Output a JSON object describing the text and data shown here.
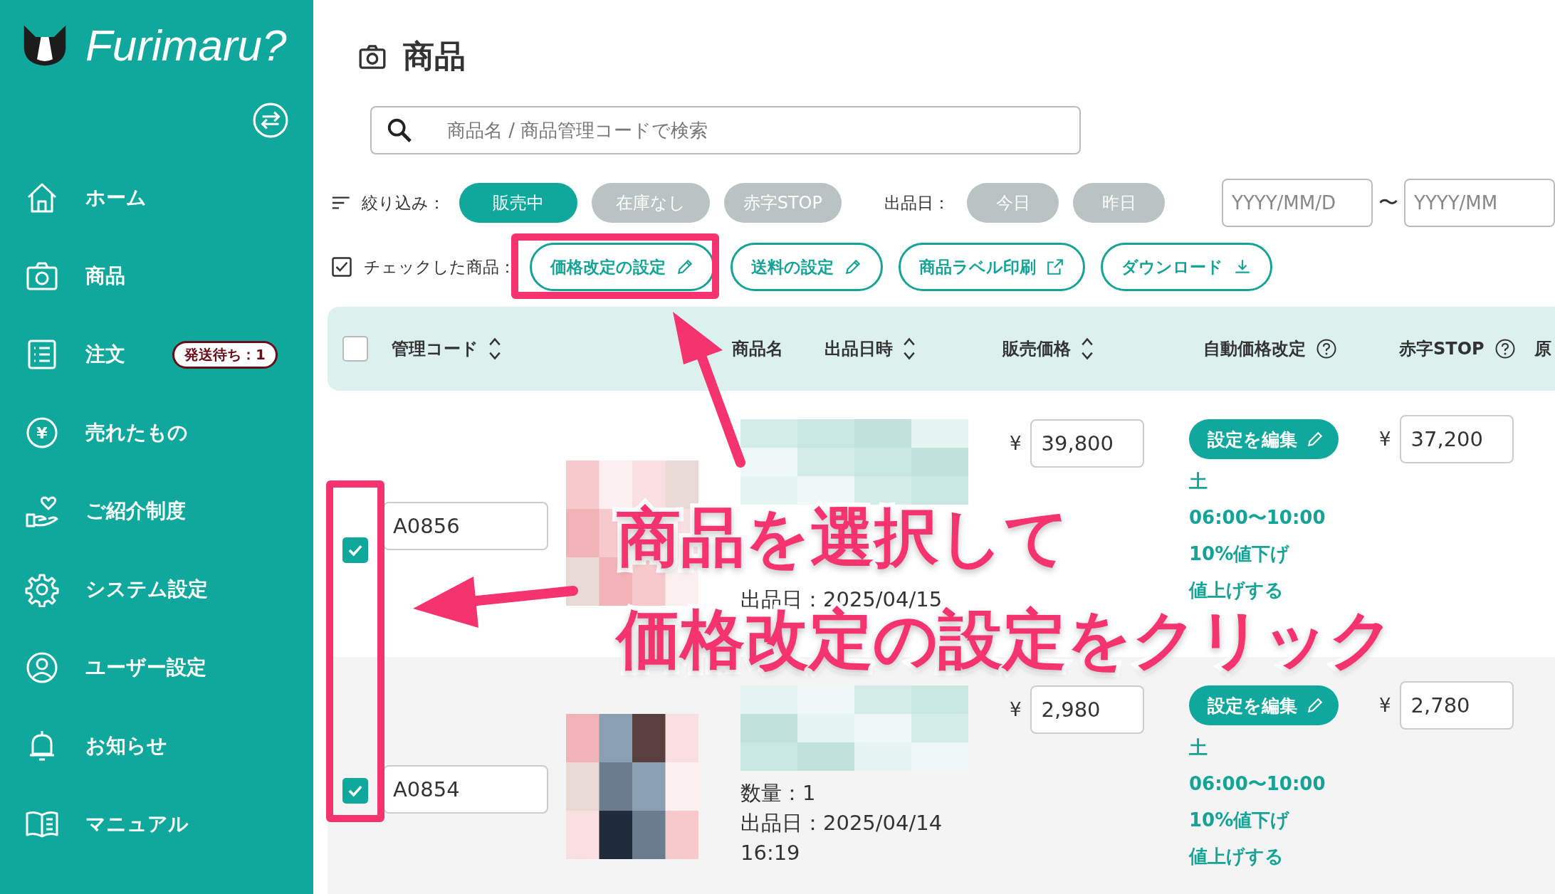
{
  "sidebar": {
    "logo": "Furimaru?",
    "items": [
      {
        "label": "ホーム"
      },
      {
        "label": "商品"
      },
      {
        "label": "注文",
        "badge": "発送待ち：1"
      },
      {
        "label": "売れたもの",
        "glyph": "¥"
      },
      {
        "label": "ご紹介制度"
      },
      {
        "label": "システム設定"
      },
      {
        "label": "ユーザー設定"
      },
      {
        "label": "お知らせ"
      },
      {
        "label": "マニュアル"
      }
    ]
  },
  "page_title": "商品",
  "search": {
    "placeholder": "商品名 / 商品管理コードで検索"
  },
  "filters": {
    "label": "絞り込み：",
    "status_chips": [
      {
        "label": "販売中",
        "selected": true
      },
      {
        "label": "在庫なし",
        "selected": false
      },
      {
        "label": "赤字STOP",
        "selected": false
      }
    ],
    "date_label": "出品日：",
    "date_chips": [
      {
        "label": "今日",
        "selected": false
      },
      {
        "label": "昨日",
        "selected": false
      }
    ],
    "date_from": {
      "placeholder": "YYYY/MM/D"
    },
    "separator": "〜",
    "date_to": {
      "placeholder": "YYYY/MM"
    }
  },
  "bulk": {
    "label": "チェックした商品：",
    "actions": [
      {
        "label": "価格改定の設定",
        "kind": "edit"
      },
      {
        "label": "送料の設定",
        "kind": "edit"
      },
      {
        "label": "商品ラベル印刷",
        "kind": "external"
      },
      {
        "label": "ダウンロード",
        "kind": "download"
      }
    ]
  },
  "table": {
    "select_all": {
      "checked": false
    },
    "columns": [
      {
        "label": "管理コード",
        "kind": "sort"
      },
      {
        "label": "商品名",
        "kind": "plain"
      },
      {
        "label": "出品日時",
        "kind": "sort"
      },
      {
        "label": "販売価格",
        "kind": "sort"
      },
      {
        "label": "自動価格改定",
        "kind": "help"
      },
      {
        "label": "赤字STOP",
        "kind": "help"
      },
      {
        "label": "原",
        "kind": "plain"
      }
    ],
    "rows": [
      {
        "checked": true,
        "code": "A0856",
        "listed": "出品日：2025/04/15",
        "price_currency": "¥",
        "price": "39,800",
        "edit": "設定を編集",
        "schedule": [
          "土",
          "06:00〜10:00",
          "10%値下げ",
          "値上げする"
        ],
        "stop_currency": "¥",
        "stop": "37,200"
      },
      {
        "checked": true,
        "code": "A0854",
        "quantity": "数量：1",
        "listed": "出品日：2025/04/14",
        "time": "16:19",
        "price_currency": "¥",
        "price": "2,980",
        "edit": "設定を編集",
        "schedule": [
          "土",
          "06:00〜10:00",
          "10%値下げ",
          "値上げする"
        ],
        "stop_currency": "¥",
        "stop": "2,780"
      }
    ]
  },
  "annotation": {
    "callouts": [
      "商品を選択して",
      "価格改定の設定をクリック"
    ]
  }
}
